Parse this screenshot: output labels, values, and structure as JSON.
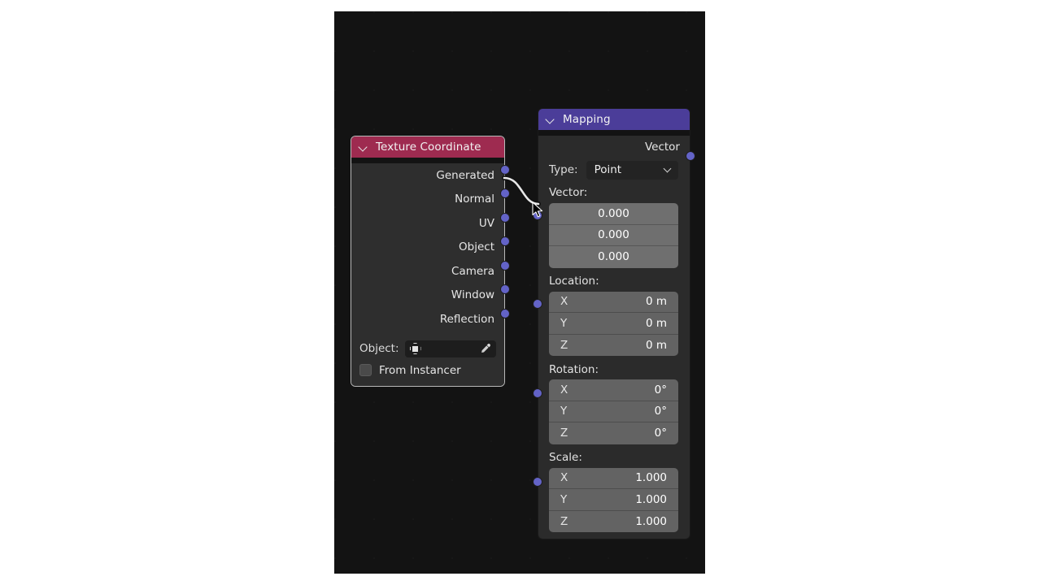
{
  "app": {
    "editor": "blender-shader-node-editor",
    "background_color": "#131313",
    "page_background": "#ffffff"
  },
  "nodes": {
    "texture_coordinate": {
      "title": "Texture Coordinate",
      "header_color": "#9e2b50",
      "collapse_icon": "chevron-down-icon",
      "selected": true,
      "outputs": [
        {
          "label": "Generated",
          "socket_color": "#6363c7",
          "connected": true
        },
        {
          "label": "Normal",
          "socket_color": "#6363c7",
          "connected": false
        },
        {
          "label": "UV",
          "socket_color": "#6363c7",
          "connected": false
        },
        {
          "label": "Object",
          "socket_color": "#6363c7",
          "connected": false
        },
        {
          "label": "Camera",
          "socket_color": "#6363c7",
          "connected": false
        },
        {
          "label": "Window",
          "socket_color": "#6363c7",
          "connected": false
        },
        {
          "label": "Reflection",
          "socket_color": "#6363c7",
          "connected": false
        }
      ],
      "object_property": {
        "label": "Object:",
        "value": "",
        "placeholder": "",
        "icon": "object-cube-icon",
        "eyedropper_icon": "eyedropper-icon"
      },
      "from_instancer": {
        "label": "From Instancer",
        "checked": false
      }
    },
    "mapping": {
      "title": "Mapping",
      "header_color": "#4b3d99",
      "collapse_icon": "chevron-down-icon",
      "selected": false,
      "output": {
        "label": "Vector",
        "socket_color": "#6363c7"
      },
      "type_property": {
        "label": "Type:",
        "value": "Point",
        "chevron_icon": "chevron-down-icon"
      },
      "vector_input": {
        "label": "Vector:",
        "socket_color": "#6363c7",
        "connected": true,
        "highlighted": true,
        "values": [
          "0.000",
          "0.000",
          "0.000"
        ]
      },
      "location_input": {
        "label": "Location:",
        "socket_color": "#6363c7",
        "connected": false,
        "axes": [
          "X",
          "Y",
          "Z"
        ],
        "values": [
          "0 m",
          "0 m",
          "0 m"
        ]
      },
      "rotation_input": {
        "label": "Rotation:",
        "socket_color": "#6363c7",
        "connected": false,
        "axes": [
          "X",
          "Y",
          "Z"
        ],
        "values": [
          "0°",
          "0°",
          "0°"
        ]
      },
      "scale_input": {
        "label": "Scale:",
        "socket_color": "#6363c7",
        "connected": false,
        "axes": [
          "X",
          "Y",
          "Z"
        ],
        "values": [
          "1.000",
          "1.000",
          "1.000"
        ]
      }
    }
  },
  "link": {
    "from": "Generated",
    "to": "Vector",
    "color": "#e8e8e8"
  },
  "cursor": {
    "icon": "mouse-arrow-cursor"
  }
}
